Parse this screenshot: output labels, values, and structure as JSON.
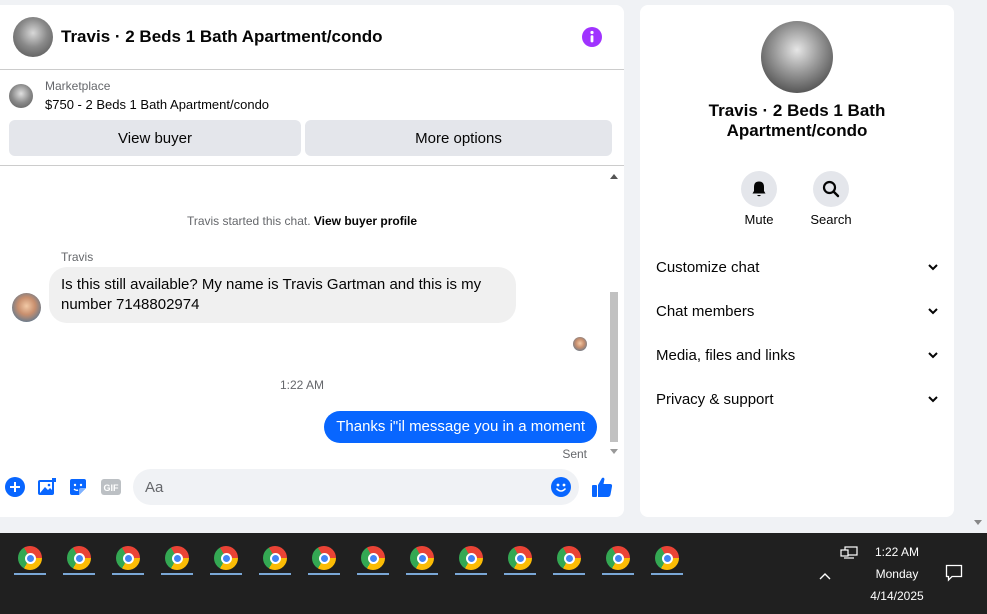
{
  "chat": {
    "title": "Travis · 2 Beds 1 Bath Apartment/condo",
    "marketplace_label": "Marketplace",
    "listing": "$750 - 2 Beds 1 Bath Apartment/condo",
    "view_buyer_label": "View buyer",
    "more_options_label": "More options",
    "system_message_prefix": "Travis started this chat.",
    "system_message_link": "View buyer profile",
    "sender_name": "Travis",
    "incoming_message": "Is this still available? My name is Travis Gartman and this is my number 7148802974",
    "timestamp": "1:22 AM",
    "outgoing_message": "Thanks i\"il message you in a moment",
    "sent_status": "Sent",
    "composer_placeholder": "Aa",
    "gif_label": "GIF"
  },
  "info": {
    "name": "Travis · 2 Beds 1 Bath Apartment/condo",
    "mute_label": "Mute",
    "search_label": "Search",
    "sections": [
      "Customize chat",
      "Chat members",
      "Media, files and links",
      "Privacy & support"
    ]
  },
  "taskbar": {
    "time": "1:22 AM",
    "day": "Monday",
    "date": "4/14/2025",
    "app_icons": [
      "chrome-icon",
      "chrome-icon",
      "chrome-icon",
      "chrome-icon",
      "chrome-icon",
      "chrome-icon",
      "chrome-icon",
      "chrome-icon",
      "chrome-icon",
      "chrome-icon",
      "chrome-icon",
      "chrome-icon",
      "chrome-icon",
      "chrome-icon"
    ]
  },
  "colors": {
    "accent": "#0866ff",
    "info_icon": "#a033ff",
    "taskbar": "#202020"
  }
}
